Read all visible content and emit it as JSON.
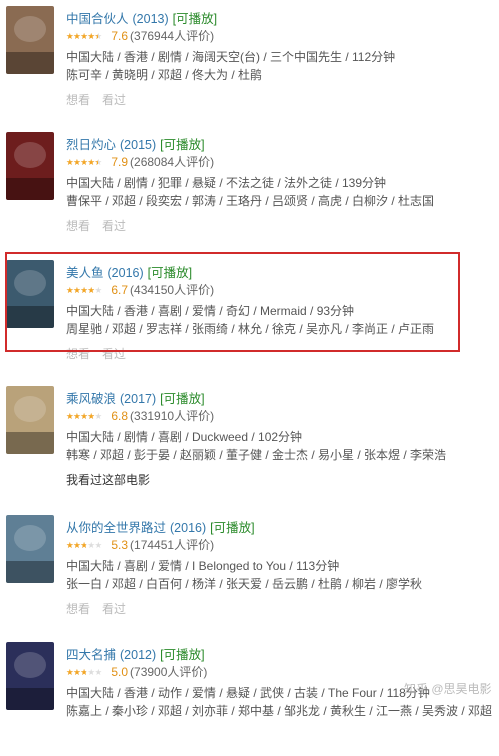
{
  "movies": [
    {
      "title": "中国合伙人",
      "year": "(2013)",
      "playable": "[可播放]",
      "stars": 4,
      "score": "7.6",
      "count": "(376944人评价)",
      "meta1": "中国大陆 / 香港 / 剧情 / 海阔天空(台) / 三个中国先生 / 112分钟",
      "meta2": "陈可辛 / 黄晓明 / 邓超 / 佟大为 / 杜鹃",
      "want": "想看",
      "seen": "看过",
      "poster_color": "#8a6b52"
    },
    {
      "title": "烈日灼心",
      "year": "(2015)",
      "playable": "[可播放]",
      "stars": 4,
      "score": "7.9",
      "count": "(268084人评价)",
      "meta1": "中国大陆 / 剧情 / 犯罪 / 悬疑 / 不法之徒 / 法外之徒 / 139分钟",
      "meta2": "曹保平 / 邓超 / 段奕宏 / 郭涛 / 王珞丹 / 吕颂贤 / 高虎 / 白柳汐 / 杜志国",
      "want": "想看",
      "seen": "看过",
      "poster_color": "#6d1d1d"
    },
    {
      "title": "美人鱼",
      "year": "(2016)",
      "playable": "[可播放]",
      "stars": 3.5,
      "score": "6.7",
      "count": "(434150人评价)",
      "meta1": "中国大陆 / 香港 / 喜剧 / 爱情 / 奇幻 / Mermaid / 93分钟",
      "meta2": "周星驰 / 邓超 / 罗志祥 / 张雨绮 / 林允 / 徐克 / 吴亦凡 / 李尚正 / 卢正雨",
      "want": "想看",
      "seen": "看过",
      "poster_color": "#3c5a6e"
    },
    {
      "title": "乘风破浪",
      "year": "(2017)",
      "playable": "[可播放]",
      "stars": 3.5,
      "score": "6.8",
      "count": "(331910人评价)",
      "meta1": "中国大陆 / 剧情 / 喜剧 / Duckweed / 102分钟",
      "meta2": "韩寒 / 邓超 / 彭于晏 / 赵丽颖 / 董子健 / 金士杰 / 易小星 / 张本煜 / 李荣浩",
      "seen_note": "我看过这部电影",
      "poster_color": "#b9a27a"
    },
    {
      "title": "从你的全世界路过",
      "year": "(2016)",
      "playable": "[可播放]",
      "stars": 2.5,
      "score": "5.3",
      "count": "(174451人评价)",
      "meta1": "中国大陆 / 喜剧 / 爱情 / I Belonged to You / 113分钟",
      "meta2": "张一白 / 邓超 / 白百何 / 杨洋 / 张天爱 / 岳云鹏 / 杜鹃 / 柳岩 / 廖学秋",
      "want": "想看",
      "seen": "看过",
      "poster_color": "#5f7f95"
    },
    {
      "title": "四大名捕",
      "year": "(2012)",
      "playable": "[可播放]",
      "stars": 2.5,
      "score": "5.0",
      "count": "(73900人评价)",
      "meta1": "中国大陆 / 香港 / 动作 / 爱情 / 悬疑 / 武侠 / 古装 / The Four / 118分钟",
      "meta2": "陈嘉上 / 秦小珍 / 邓超 / 刘亦菲 / 郑中基 / 邹兆龙 / 黄秋生 / 江一燕 / 吴秀波 / 邓超",
      "poster_color": "#2b2f5a"
    }
  ],
  "watermark": "知乎 @思昊电影"
}
